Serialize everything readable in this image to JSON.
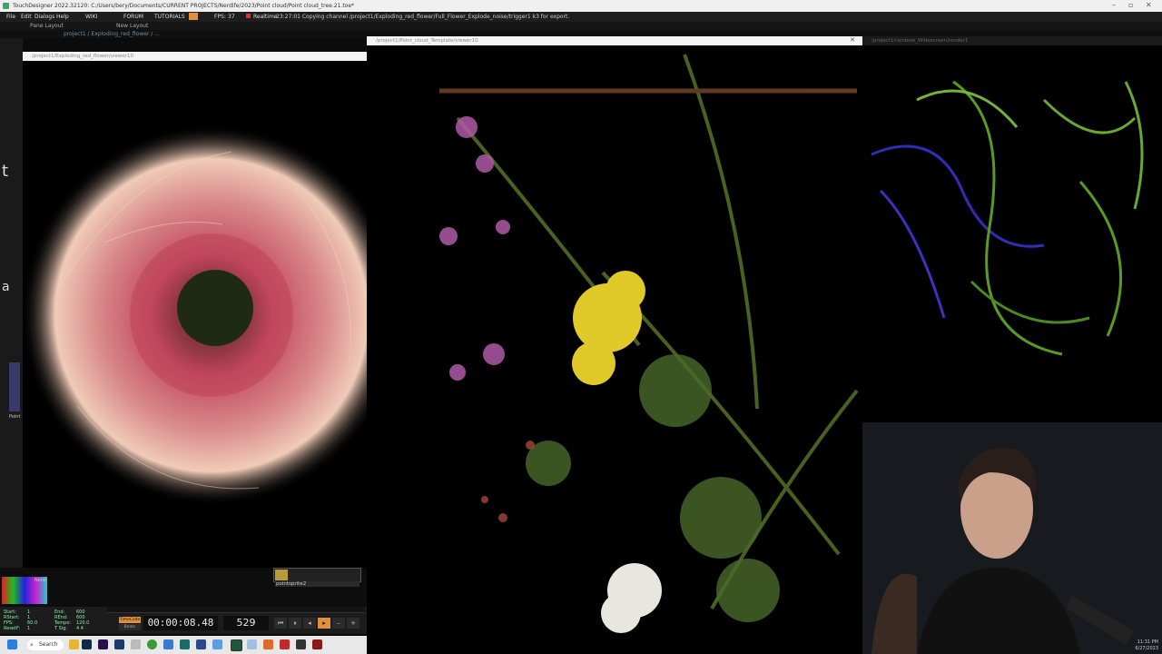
{
  "app": {
    "title": "TouchDesigner 2022.32120: C:/Users/bery/Documents/CURRENT PROJECTS/Nerdife/2023/Point cloud/Point cloud_tree.21.toe*",
    "status": "23:27:01 Copying channel /project1/Exploding_red_flower/Full_Flower_Explode_noise/trigger1 k3 for export."
  },
  "menu": {
    "file": "File",
    "edit": "Edit",
    "dialogs": "Dialogs",
    "help": "Help",
    "wiki": "WIKI",
    "forum": "FORUM",
    "tutorials": "TUTORIALS",
    "fps_label": "FPS:",
    "fps_value": "37",
    "realtime": "Realtime"
  },
  "toolbar": {
    "pane_layout": "Pane Layout",
    "new_layout": "New Layout"
  },
  "path": {
    "text": "project1 / Exploding_red_flower / ..."
  },
  "viewers": {
    "left": "/project1/Exploding_red_flower/viewer10",
    "center": "/project1/Point_cloud_Template/viewer10",
    "right": "/project1/rainbow_Widescreen/render1"
  },
  "node": {
    "label": "pointsprite2",
    "mode": "None",
    "sidebar_label": "Point"
  },
  "timeline": {
    "start_label": "Start:",
    "start": "1",
    "end_label": "End:",
    "end": "600",
    "rstart_label": "RStart:",
    "rstart": "1",
    "rend_label": "REnd:",
    "rend": "600",
    "fps_label": "FPS:",
    "fps": "60.0",
    "tempo_label": "Tempo:",
    "tempo": "120.0",
    "resetf_label": "ResetF:",
    "resetf": "1",
    "tsig_label": "T Sig:",
    "tsig": "4   4",
    "timecode_btn": "TimeCode",
    "beats_btn": "Beats",
    "timecode": "00:00:08.48",
    "frame": "529"
  },
  "taskbar": {
    "search": "Search",
    "time": "11:31 PM",
    "date": "6/27/2023"
  },
  "colors": {
    "accent": "#e0903a",
    "record": "#e03030"
  },
  "icons": [
    "windows-icon",
    "search-icon",
    "folder-icon",
    "photoshop-icon",
    "premiere-icon",
    "media-icon",
    "chrome-icon",
    "touchdesigner-icon"
  ]
}
